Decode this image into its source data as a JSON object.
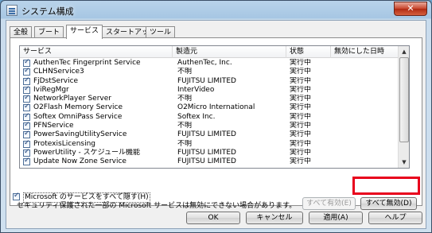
{
  "window": {
    "title": "システム構成",
    "close_glyph": "✕"
  },
  "tabs": [
    {
      "label": "全般"
    },
    {
      "label": "ブート"
    },
    {
      "label": "サービス"
    },
    {
      "label": "スタートアップ"
    },
    {
      "label": "ツール"
    }
  ],
  "columns": {
    "service": "サービス",
    "manufacturer": "製造元",
    "status": "状態",
    "disabled_date": "無効にした日時"
  },
  "rows": [
    {
      "service": "AuthenTec Fingerprint Service",
      "manufacturer": "AuthenTec, Inc.",
      "status": "実行中",
      "checked": true
    },
    {
      "service": "CLHNService3",
      "manufacturer": "不明",
      "status": "実行中",
      "checked": true
    },
    {
      "service": "FjDstService",
      "manufacturer": "FUJITSU LIMITED",
      "status": "実行中",
      "checked": true
    },
    {
      "service": "IviRegMgr",
      "manufacturer": "InterVideo",
      "status": "実行中",
      "checked": true
    },
    {
      "service": "NetworkPlayer Server",
      "manufacturer": "不明",
      "status": "実行中",
      "checked": true
    },
    {
      "service": "O2Flash Memory Service",
      "manufacturer": "O2Micro International",
      "status": "実行中",
      "checked": true
    },
    {
      "service": "Softex OmniPass Service",
      "manufacturer": "Softex Inc.",
      "status": "実行中",
      "checked": true
    },
    {
      "service": "PFNService",
      "manufacturer": "不明",
      "status": "実行中",
      "checked": true
    },
    {
      "service": "PowerSavingUtilityService",
      "manufacturer": "FUJITSU LIMITED",
      "status": "実行中",
      "checked": true
    },
    {
      "service": "ProtexisLicensing",
      "manufacturer": "不明",
      "status": "実行中",
      "checked": true
    },
    {
      "service": "PowerUtility - スケジュール機能",
      "manufacturer": "FUJITSU LIMITED",
      "status": "実行中",
      "checked": true
    },
    {
      "service": "Update Now Zone Service",
      "manufacturer": "FUJITSU LIMITED",
      "status": "実行中",
      "checked": true
    }
  ],
  "note": "セキュリティ保護された一部の Microsoft サービスは無効にできない場合があります。",
  "enable_all_label": "すべて有効(E)",
  "disable_all_label": "すべて無効(D)",
  "hide_ms_label": "Microsoft のサービスをすべて隠す(H)",
  "buttons": {
    "ok": "OK",
    "cancel": "キャンセル",
    "apply": "適用(A)",
    "help": "ヘルプ"
  },
  "colors": {
    "highlight": "#e8001c",
    "title_bar": "#a6c6e3"
  }
}
